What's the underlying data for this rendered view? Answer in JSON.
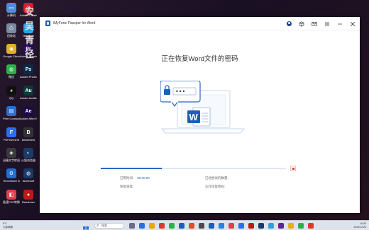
{
  "desktop": {
    "icons": [
      {
        "label": "计算机",
        "color": "#4b8fd8",
        "glyph": "▭"
      },
      {
        "label": "回收站",
        "color": "#7a8aa0",
        "glyph": "♺"
      },
      {
        "label": "Google Chrome",
        "color": "#e0b020",
        "glyph": "◉"
      },
      {
        "label": "微信",
        "color": "#2bb24c",
        "glyph": "◍"
      },
      {
        "label": "QQ",
        "color": "#111111",
        "glyph": "◕"
      },
      {
        "label": "Print Conductor",
        "color": "#2a6fcf",
        "glyph": "▤"
      },
      {
        "label": "PDFelement",
        "color": "#2d6df6",
        "glyph": "F"
      },
      {
        "label": "迅捷文字转语音",
        "color": "#3a3a3a",
        "glyph": "◈"
      },
      {
        "label": "Tenorshare 4uKey",
        "color": "#1e6fd9",
        "glyph": "⚙"
      },
      {
        "label": "极速PDF转换",
        "color": "#e0404e",
        "glyph": "◧"
      },
      {
        "label": "Adobe Creative Cloud",
        "color": "#da1f26",
        "glyph": "◎"
      },
      {
        "label": "Telegram",
        "color": "#2aa3df",
        "glyph": "➤"
      },
      {
        "label": "Adobe Premiere",
        "color": "#2a0b5a",
        "glyph": "Pr"
      },
      {
        "label": "Adobe Photoshop",
        "color": "#0a2a4a",
        "glyph": "Ps"
      },
      {
        "label": "Adobe Audition",
        "color": "#0a3a3a",
        "glyph": "Au"
      },
      {
        "label": "Adobe After Effects",
        "color": "#1a0a4a",
        "glyph": "Ae"
      },
      {
        "label": "Bandiview",
        "color": "#333333",
        "glyph": "B"
      },
      {
        "label": "火狐浏览器",
        "color": "#1a3a6a",
        "glyph": "◐"
      },
      {
        "label": "Aiseesoft",
        "color": "#1a3a6a",
        "glyph": "◍"
      },
      {
        "label": "Bandicam",
        "color": "#c01818",
        "glyph": "●"
      }
    ],
    "wallpaper_text": [
      "安",
      "吴",
      "青",
      "径"
    ]
  },
  "window": {
    "app_title": "iMyFone Passper for Word",
    "toolbar_icons": [
      "user-icon",
      "cube-icon",
      "mail-icon",
      "menu-icon",
      "minimize-icon",
      "close-icon"
    ],
    "heading": "正在恢复Word文件的密码",
    "password_mask": "•••",
    "progress_fraction": 0.33,
    "stats": {
      "elapsed_label": "已用时间:",
      "elapsed_value": "00:00:00",
      "attempted_label": "已经尝试的数量:",
      "attempted_value": "",
      "speed_label": "恢复速度:",
      "speed_value": "",
      "status_label": "正在恢复密码:",
      "status_value": ""
    },
    "colors": {
      "accent": "#2b66c4",
      "stop": "#e0453a"
    }
  },
  "taskbar": {
    "weather": "8°C",
    "weather_sub": "大部晴朗",
    "search_placeholder": "搜索",
    "clock_time": "16:09",
    "clock_date": "2024/12/26"
  }
}
